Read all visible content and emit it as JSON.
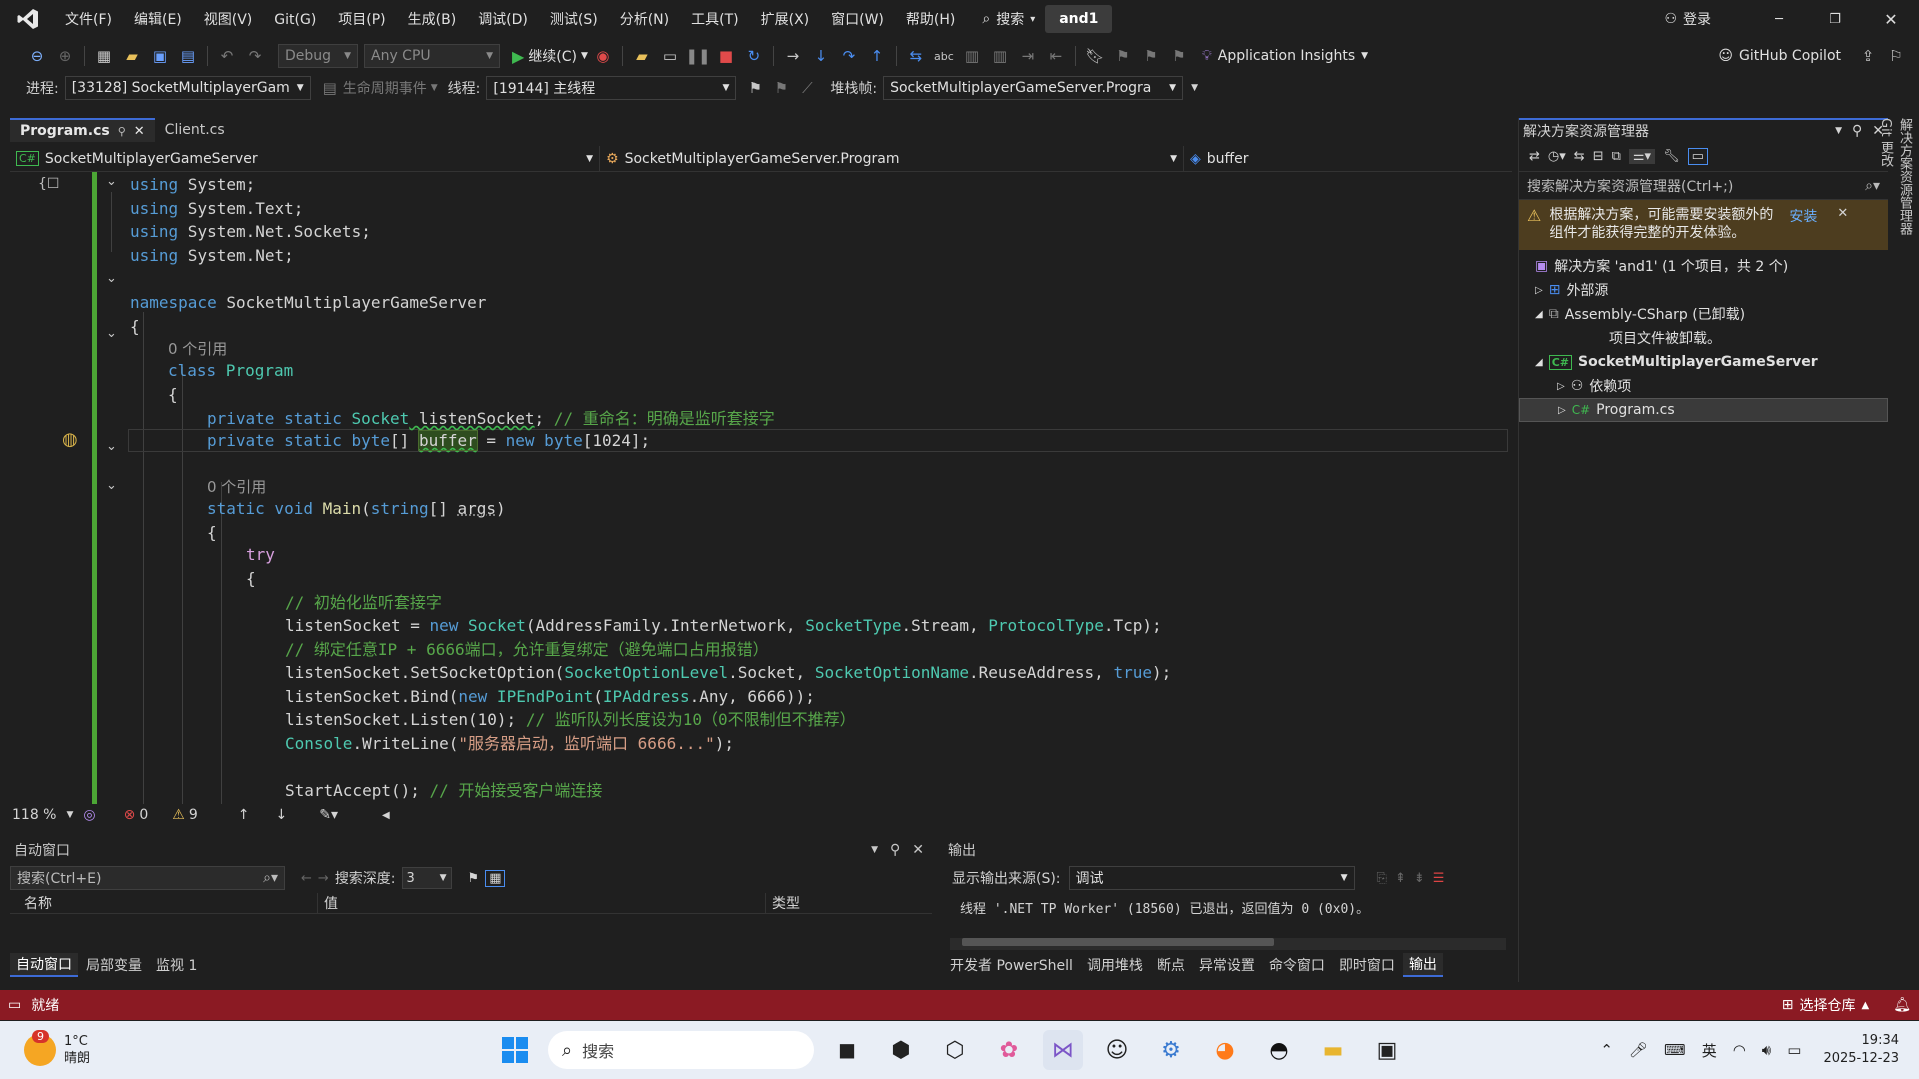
{
  "menubar": {
    "items": [
      "文件(F)",
      "编辑(E)",
      "视图(V)",
      "Git(G)",
      "项目(P)",
      "生成(B)",
      "调试(D)",
      "测试(S)",
      "分析(N)",
      "工具(T)",
      "扩展(X)",
      "窗口(W)",
      "帮助(H)"
    ],
    "search_label": "搜索",
    "solution_name": "and1",
    "login_label": "登录"
  },
  "toolbar": {
    "config": "Debug",
    "platform": "Any CPU",
    "continue_label": "继续(C)",
    "app_insights": "Application Insights",
    "copilot": "GitHub Copilot"
  },
  "toolbar2": {
    "process_label": "进程:",
    "process_value": "[33128] SocketMultiplayerGam",
    "lifecycle_label": "生命周期事件",
    "thread_label": "线程:",
    "thread_value": "[19144] 主线程",
    "stackframe_label": "堆栈帧:",
    "stackframe_value": "SocketMultiplayerGameServer.Progra"
  },
  "tabs": [
    {
      "label": "Program.cs"
    },
    {
      "label": "Client.cs"
    }
  ],
  "navbar": {
    "project": "SocketMultiplayerGameServer",
    "class": "SocketMultiplayerGameServer.Program",
    "member": "buffer"
  },
  "code": {
    "l1_kw": "using",
    "l1_rest": " System;",
    "l2_kw": "using",
    "l2_rest": " System.Text;",
    "l3_kw": "using",
    "l3_rest": " System.Net.Sockets;",
    "l4_kw": "using",
    "l4_rest": " System.Net;",
    "l6_kw": "namespace",
    "l6_rest": " SocketMultiplayerGameServer",
    "l7": "{",
    "ref1": "0 个引用",
    "l8_kw": "class",
    "l8_ty": " Program",
    "l9": "{",
    "l10_kw": "private static",
    "l10_ty": " Socket",
    "l10_id": " listenSocket",
    "l10_pl": ";",
    "l10_cm": " // 重命名：明确是监听套接字",
    "l11_kw": "private static",
    "l11_kw2": " byte",
    "l11_pl": "[] ",
    "l11_id": "buffer",
    "l11_pl2": " = ",
    "l11_kw3": "new",
    "l11_kw4": " byte",
    "l11_pl3": "[1024];",
    "ref2": "0 个引用",
    "l13_kw": "static void",
    "l13_fn": " Main",
    "l13_pl": "(",
    "l13_kw2": "string",
    "l13_pl2": "[] ",
    "l13_id": "args",
    "l13_pl3": ")",
    "l14": "{",
    "l15_kw": "try",
    "l16": "{",
    "l17_cm": "// 初始化监听套接字",
    "l18_pl": "listenSocket = ",
    "l18_kw": "new",
    "l18_ty": " Socket",
    "l18_pl2": "(AddressFamily.InterNetwork, ",
    "l18_ty2": "SocketType",
    "l18_pl3": ".Stream, ",
    "l18_ty3": "ProtocolType",
    "l18_pl4": ".Tcp);",
    "l19_cm": "// 绑定任意IP + 6666端口，允许重复绑定（避免端口占用报错）",
    "l20_pl": "listenSocket.SetSocketOption(",
    "l20_ty": "SocketOptionLevel",
    "l20_pl2": ".Socket, ",
    "l20_ty2": "SocketOptionName",
    "l20_pl3": ".ReuseAddress, ",
    "l20_kw": "true",
    "l20_pl4": ");",
    "l21_pl": "listenSocket.Bind(",
    "l21_kw": "new",
    "l21_ty": " IPEndPoint",
    "l21_pl2": "(",
    "l21_ty2": "IPAddress",
    "l21_pl3": ".Any, 6666));",
    "l22_pl": "listenSocket.Listen(10);",
    "l22_cm": " // 监听队列长度设为10（0不限制但不推荐）",
    "l23_ty": "Console",
    "l23_pl": ".WriteLine(",
    "l23_st": "\"服务器启动，监听端口 6666...\"",
    "l23_pl2": ");",
    "l25_pl": "StartAccept();",
    "l25_cm": " // 开始接受客户端连接"
  },
  "editor_status": {
    "zoom": "118 %",
    "errors": "0",
    "warnings": "9"
  },
  "autos": {
    "title": "自动窗口",
    "search_placeholder": "搜索(Ctrl+E)",
    "depth_label": "搜索深度:",
    "depth_value": "3",
    "col_name": "名称",
    "col_value": "值",
    "col_type": "类型",
    "tabs": [
      "自动窗口",
      "局部变量",
      "监视 1"
    ]
  },
  "output": {
    "title": "输出",
    "source_label": "显示输出来源(S):",
    "source_value": "调试",
    "line1": "线程 '.NET TP Worker' (18560) 已退出，返回值为 0 (0x0)。",
    "tabs": [
      "开发者 PowerShell",
      "调用堆栈",
      "断点",
      "异常设置",
      "命令窗口",
      "即时窗口",
      "输出"
    ]
  },
  "solution_explorer": {
    "title": "解决方案资源管理器",
    "search_placeholder": "搜索解决方案资源管理器(Ctrl+;)",
    "warning_text": "根据解决方案，可能需要安装额外的组件才能获得完整的开发体验。",
    "install_label": "安装",
    "items": [
      {
        "label": "解决方案 'and1' (1 个项目，共 2 个)"
      },
      {
        "label": "外部源"
      },
      {
        "label": "Assembly-CSharp (已卸载)"
      },
      {
        "label": "项目文件被卸载。"
      },
      {
        "label": "SocketMultiplayerGameServer"
      },
      {
        "label": "依赖项"
      },
      {
        "label": "Program.cs"
      }
    ],
    "side_tabs": [
      "解决方案资源管理器",
      "Git 更改"
    ]
  },
  "statusbar": {
    "ready": "就绪",
    "repo": "选择仓库"
  },
  "taskbar": {
    "weather_temp": "1°C",
    "weather_desc": "晴朗",
    "weather_badge": "9",
    "search": "搜索",
    "lang": "英",
    "time": "19:34",
    "date": "2025-12-23"
  },
  "colors": {
    "accent": "#3d6bd6",
    "status_bar": "#8b1a23",
    "change_bar": "#4ca635"
  }
}
